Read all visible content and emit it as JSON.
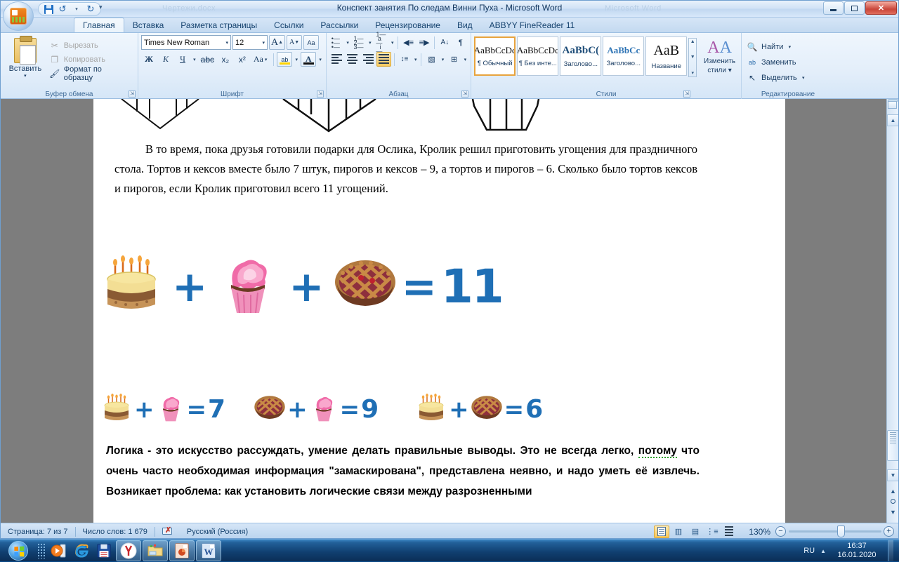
{
  "window": {
    "title": "Конспект занятия По следам Винни Пуха - Microsoft Word",
    "ghost_title_left": "Чертежи.docx",
    "ghost_title_right": "Microsoft Word",
    "minimize_label": "—",
    "maximize_label": "❐",
    "close_label": "✕"
  },
  "quick_access": {
    "office_button": "office-orb",
    "save_label": "Сохранить",
    "undo_label": "Отменить",
    "redo_label": "Вернуть",
    "undo_caret": "▾",
    "more_caret": "▾"
  },
  "tabs": [
    {
      "label": "Главная",
      "active": true
    },
    {
      "label": "Вставка",
      "active": false
    },
    {
      "label": "Разметка страницы",
      "active": false
    },
    {
      "label": "Ссылки",
      "active": false
    },
    {
      "label": "Рассылки",
      "active": false
    },
    {
      "label": "Рецензирование",
      "active": false
    },
    {
      "label": "Вид",
      "active": false
    },
    {
      "label": "ABBYY FineReader 11",
      "active": false
    }
  ],
  "ribbon": {
    "clipboard": {
      "group_label": "Буфер обмена",
      "paste_label": "Вставить",
      "paste_caret": "▾",
      "cut_label": "Вырезать",
      "copy_label": "Копировать",
      "format_painter_label": "Формат по образцу",
      "cut_icon": "✂",
      "copy_icon": "❐",
      "painter_icon": "🖌"
    },
    "font": {
      "group_label": "Шрифт",
      "font_name": "Times New Roman",
      "font_size": "12",
      "grow_font": "A",
      "shrink_font": "A",
      "clear_format": "Aa",
      "bold": "Ж",
      "italic": "К",
      "underline": "Ч",
      "strikethrough": "abc",
      "subscript": "x₂",
      "superscript": "x²",
      "change_case": "Aa",
      "highlight": "ab",
      "font_color": "A",
      "caret": "▾"
    },
    "paragraph": {
      "group_label": "Абзац",
      "bullets": "bullet-list-icon",
      "numbering": "numbered-list-icon",
      "multilevel": "multilevel-list-icon",
      "decrease_indent": "◀≡",
      "increase_indent": "≡▶",
      "sort": "A↓",
      "show_marks": "¶",
      "align_left": "align-left-icon",
      "align_center": "align-center-icon",
      "align_right": "align-right-icon",
      "align_justify": "align-justify-icon",
      "line_spacing": "↕≡",
      "shading": "shading-icon",
      "borders": "borders-icon",
      "caret": "▾"
    },
    "styles": {
      "group_label": "Стили",
      "items": [
        {
          "sample": "AaBbCcDc",
          "name": "¶ Обычный",
          "selected": true
        },
        {
          "sample": "AaBbCcDc",
          "name": "¶ Без инте...",
          "selected": false
        },
        {
          "sample": "AaBbC(",
          "name": "Заголово...",
          "selected": false
        },
        {
          "sample": "AaBbCc",
          "name": "Заголово...",
          "selected": false
        },
        {
          "sample": "AaB",
          "name": "Название",
          "selected": false
        }
      ],
      "scroll_up": "▲",
      "scroll_down": "▼",
      "scroll_more": "▾",
      "change_styles_line1": "Изменить",
      "change_styles_line2": "стили",
      "change_styles_caret": "▾"
    },
    "editing": {
      "group_label": "Редактирование",
      "find_label": "Найти",
      "replace_label": "Заменить",
      "select_label": "Выделить",
      "find_icon": "🔍",
      "replace_icon": "ab",
      "select_icon": "↖",
      "caret": "▾"
    }
  },
  "document": {
    "paragraph_1": "В то время, пока друзья готовили подарки для Ослика, Кролик решил приготовить угощения для праздничного стола. Тортов и кексов вместе было 7 штук, пирогов и кексов – 9, а тортов и пирогов – 6. Сколько было тортов кексов и пирогов, если Кролик приготовил всего 11 угощений.",
    "paragraph_2_part1": "Логика - это искусство рассуждать, умение делать правильные выводы. Это не всегда легко, ",
    "paragraph_2_spell": "потому",
    "paragraph_2_part2": " что очень часто необходимая информация \"замаскирована\", представлена неявно, и надо уметь её извлечь. Возникает проблема: как установить логические связи между разрозненными",
    "main_equation": {
      "terms": [
        "cake-icon",
        "cupcake-icon",
        "pie-icon"
      ],
      "plus": "+",
      "equals": "=",
      "result": "11"
    },
    "sub_equations": [
      {
        "left": "cake-icon",
        "plus": "+",
        "right": "cupcake-icon",
        "equals": "=",
        "result": "7"
      },
      {
        "left": "pie-icon",
        "plus": "+",
        "right": "cupcake-icon",
        "equals": "=",
        "result": "9"
      },
      {
        "left": "cake-icon",
        "plus": "+",
        "right": "pie-icon",
        "equals": "=",
        "result": "6"
      }
    ],
    "accent_color": "#1f6fb5"
  },
  "status_bar": {
    "page_info": "Страница: 7 из 7",
    "word_count": "Число слов: 1 679",
    "proofing_icon": "proofing-errors-icon",
    "language": "Русский (Россия)",
    "views": [
      {
        "name": "print-layout-view",
        "selected": true
      },
      {
        "name": "full-screen-reading-view",
        "selected": false
      },
      {
        "name": "web-layout-view",
        "selected": false
      },
      {
        "name": "outline-view",
        "selected": false
      },
      {
        "name": "draft-view",
        "selected": false
      }
    ],
    "zoom_level": "130%",
    "zoom_out": "−",
    "zoom_in": "+"
  },
  "taskbar": {
    "start_button": "windows-start-orb",
    "quick_launch": [
      {
        "name": "media-player-icon"
      },
      {
        "name": "internet-explorer-icon"
      },
      {
        "name": "floppy-save-icon"
      }
    ],
    "running": [
      {
        "name": "yandex-browser-button"
      },
      {
        "name": "file-explorer-button"
      },
      {
        "name": "powerpoint-button"
      },
      {
        "name": "word-button"
      }
    ],
    "tray_language": "RU",
    "tray_arrow": "▲",
    "clock_time": "16:37",
    "clock_date": "16.01.2020"
  }
}
